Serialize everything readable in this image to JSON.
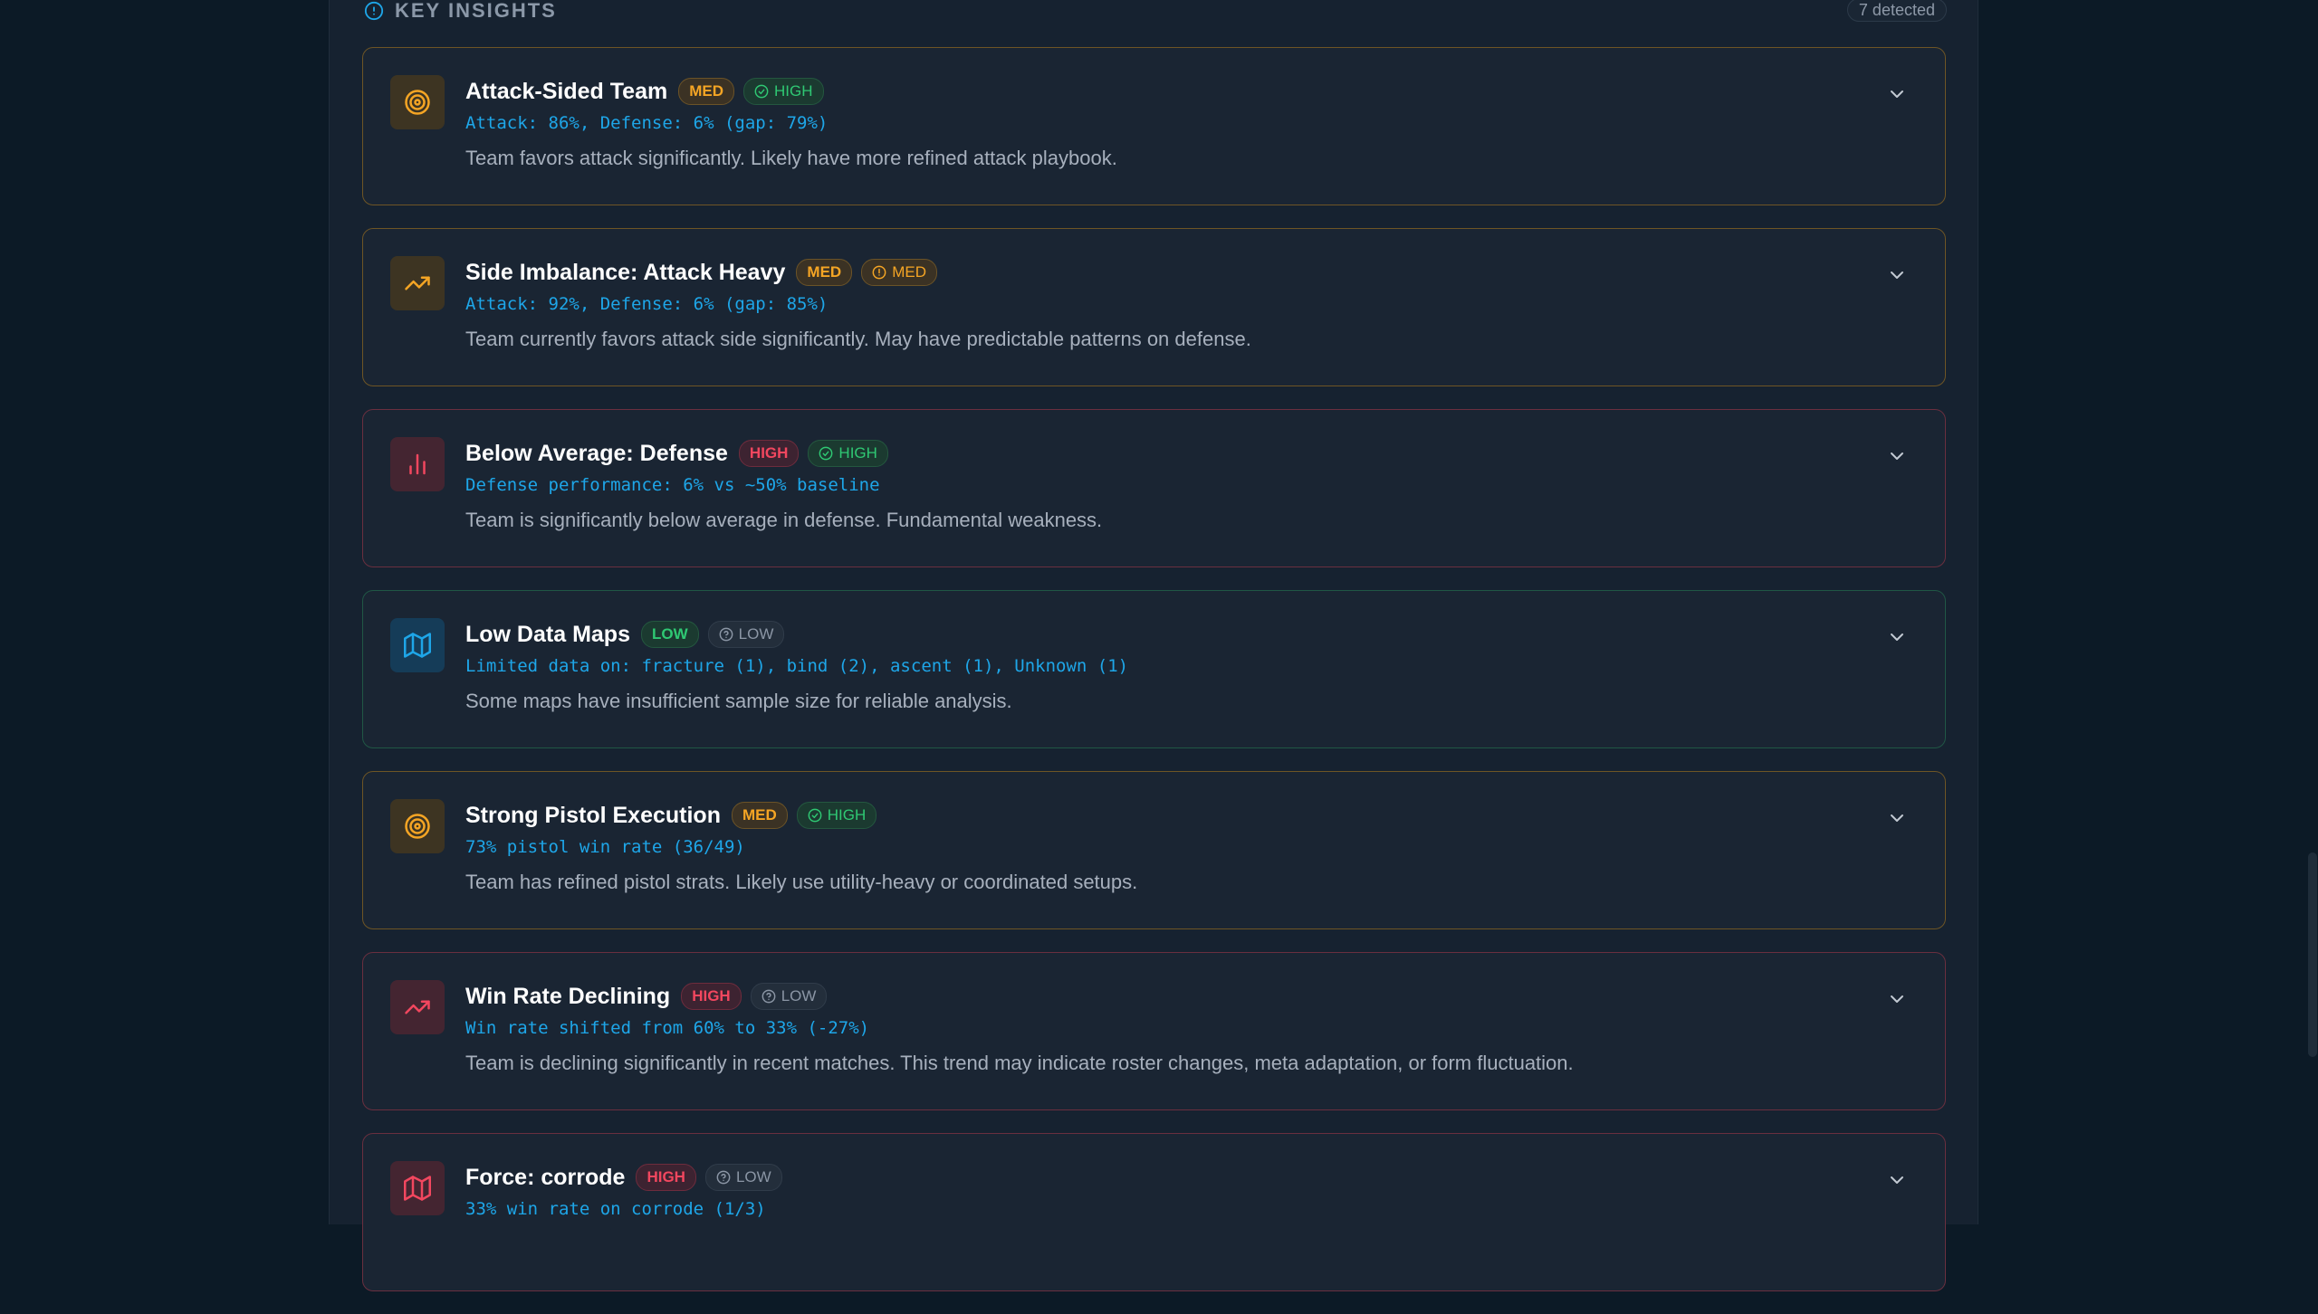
{
  "section": {
    "icon": "info-circle-icon",
    "title": "KEY INSIGHTS",
    "count": "7 detected"
  },
  "colors": {
    "background": "#0c1a26",
    "panel": "#162230",
    "metric_text": "#1ea6e8",
    "severity_med": "#f5a524",
    "severity_high": "#f2475f",
    "severity_low": "#2fc873",
    "confidence_low": "#8b96a5"
  },
  "insights": [
    {
      "icon": "target-icon",
      "color": "orange",
      "title": "Attack-Sided Team",
      "severity": "MED",
      "confidence_icon": "check-circle-icon",
      "confidence": "HIGH",
      "metric": "Attack: 86%, Defense: 6% (gap: 79%)",
      "description": "Team favors attack significantly. Likely have more refined attack playbook."
    },
    {
      "icon": "trending-up-icon",
      "color": "orange",
      "title": "Side Imbalance: Attack Heavy",
      "severity": "MED",
      "confidence_icon": "alert-circle-icon",
      "confidence": "MED",
      "metric": "Attack: 92%, Defense: 6% (gap: 85%)",
      "description": "Team currently favors attack side significantly. May have predictable patterns on defense."
    },
    {
      "icon": "bar-chart-icon",
      "color": "red",
      "title": "Below Average: Defense",
      "severity": "HIGH",
      "confidence_icon": "check-circle-icon",
      "confidence": "HIGH",
      "metric": "Defense performance: 6% vs ~50% baseline",
      "description": "Team is significantly below average in defense. Fundamental weakness."
    },
    {
      "icon": "map-icon",
      "color": "blue",
      "title": "Low Data Maps",
      "severity": "LOW",
      "confidence_icon": "help-circle-icon",
      "confidence": "LOW",
      "metric": "Limited data on: fracture (1), bind (2), ascent (1), Unknown (1)",
      "description": "Some maps have insufficient sample size for reliable analysis."
    },
    {
      "icon": "target-icon",
      "color": "orange",
      "title": "Strong Pistol Execution",
      "severity": "MED",
      "confidence_icon": "check-circle-icon",
      "confidence": "HIGH",
      "metric": "73% pistol win rate (36/49)",
      "description": "Team has refined pistol strats. Likely use utility-heavy or coordinated setups."
    },
    {
      "icon": "trending-up-icon",
      "color": "red",
      "title": "Win Rate Declining",
      "severity": "HIGH",
      "confidence_icon": "help-circle-icon",
      "confidence": "LOW",
      "metric": "Win rate shifted from 60% to 33% (-27%)",
      "description": "Team is declining significantly in recent matches. This trend may indicate roster changes, meta adaptation, or form fluctuation."
    },
    {
      "icon": "map-icon",
      "color": "red",
      "title": "Force: corrode",
      "severity": "HIGH",
      "confidence_icon": "help-circle-icon",
      "confidence": "LOW",
      "metric": "33% win rate on corrode (1/3)",
      "description": ""
    }
  ],
  "expand_icon": "chevron-down-icon"
}
